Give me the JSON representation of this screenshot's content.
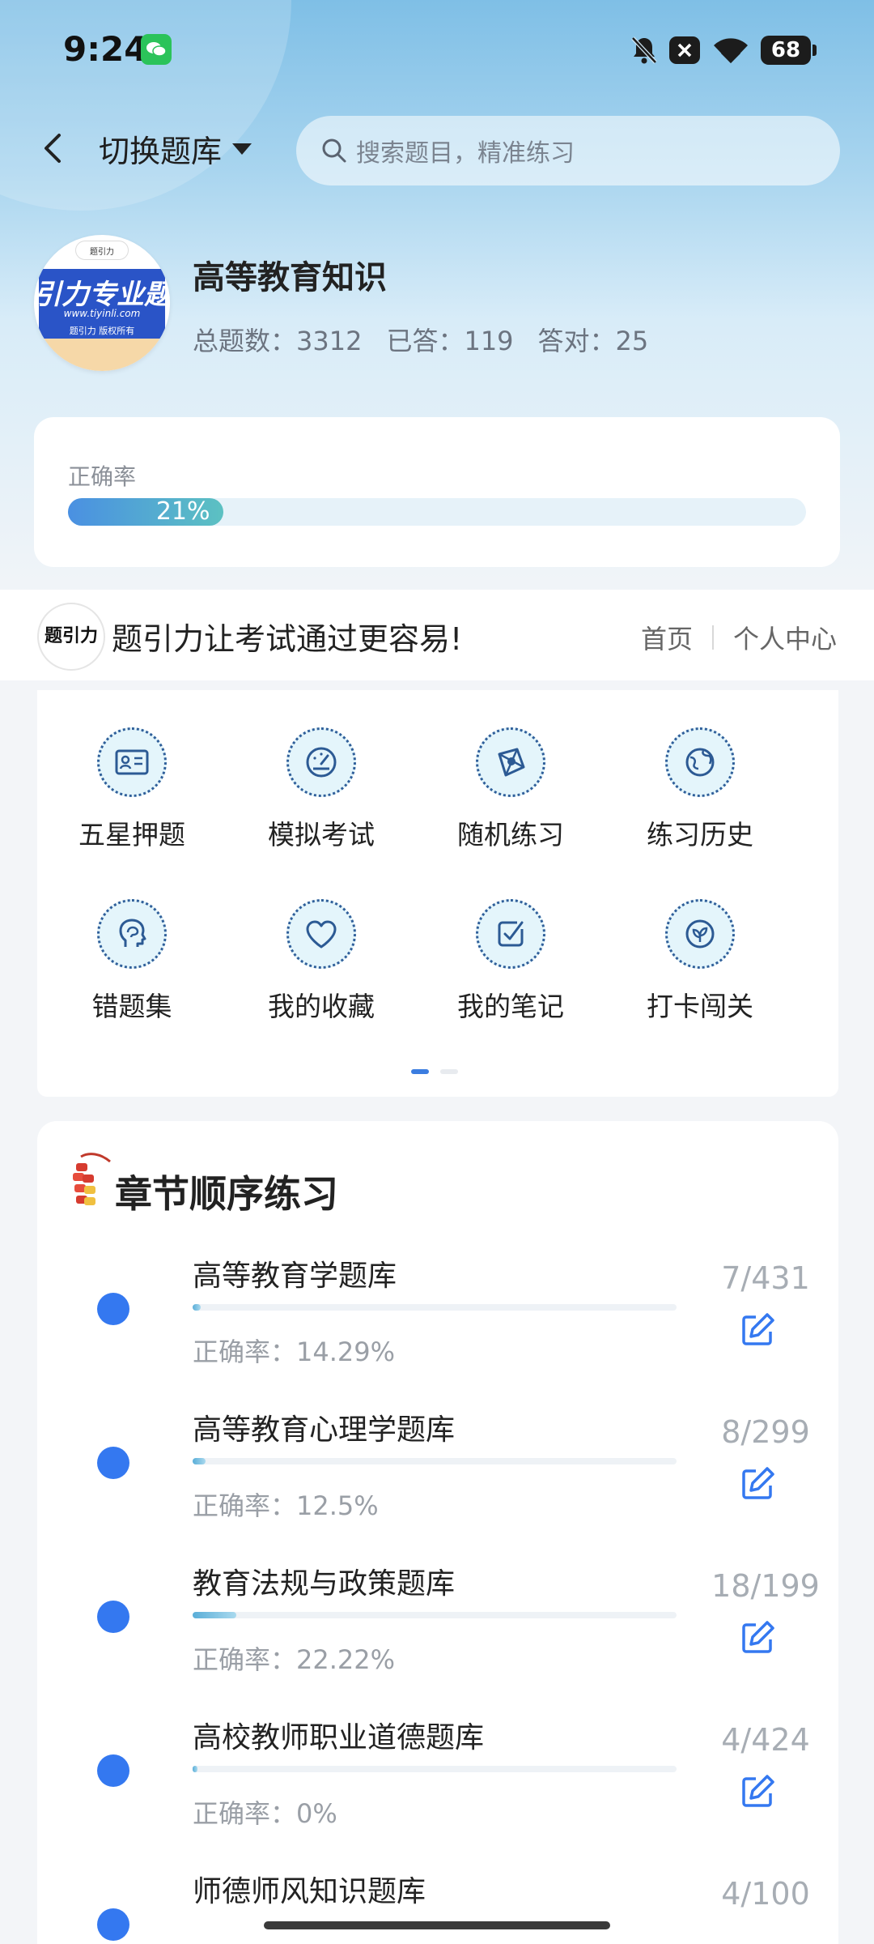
{
  "status": {
    "time": "9:24",
    "battery": "68"
  },
  "nav": {
    "switch_label": "切换题库",
    "search_placeholder": "搜索题目，精准练习"
  },
  "bank": {
    "logo_top": "题引力",
    "logo_text": "引力专业题",
    "logo_url": "www.tiyinli.com",
    "logo_copy": "题引力 版权所有",
    "title": "高等教育知识",
    "total": "总题数：3312",
    "answered": "已答：119",
    "correct": "答对：25"
  },
  "accuracy": {
    "label": "正确率",
    "value_text": "21%",
    "value": 21
  },
  "banner": {
    "logo_text": "题引力",
    "text": "题引力让考试通过更容易!",
    "home": "首页",
    "personal": "个人中心"
  },
  "features": [
    {
      "label": "五星押题",
      "icon": "id-card-icon"
    },
    {
      "label": "模拟考试",
      "icon": "speedometer-icon"
    },
    {
      "label": "随机练习",
      "icon": "network-icon"
    },
    {
      "label": "练习历史",
      "icon": "globe-icon"
    },
    {
      "label": "错题集",
      "icon": "brain-head-icon"
    },
    {
      "label": "我的收藏",
      "icon": "heart-icon"
    },
    {
      "label": "我的笔记",
      "icon": "note-check-icon"
    },
    {
      "label": "打卡闯关",
      "icon": "leaf-icon"
    }
  ],
  "chapters": {
    "title": "章节顺序练习",
    "items": [
      {
        "name": "高等教育学题库",
        "accuracy": "正确率：14.29%",
        "count": "7/431",
        "progress": 0.016
      },
      {
        "name": "高等教育心理学题库",
        "accuracy": "正确率：12.5%",
        "count": "8/299",
        "progress": 0.027
      },
      {
        "name": "教育法规与政策题库",
        "accuracy": "正确率：22.22%",
        "count": "18/199",
        "progress": 0.09
      },
      {
        "name": "高校教师职业道德题库",
        "accuracy": "正确率：0%",
        "count": "4/424",
        "progress": 0.009
      },
      {
        "name": "师德师风知识题库",
        "accuracy": "",
        "count": "4/100",
        "progress": 0.04
      }
    ]
  },
  "colors": {
    "accent": "#3478f0",
    "progress_start": "#4a90e2",
    "progress_end": "#5cc1c2"
  }
}
